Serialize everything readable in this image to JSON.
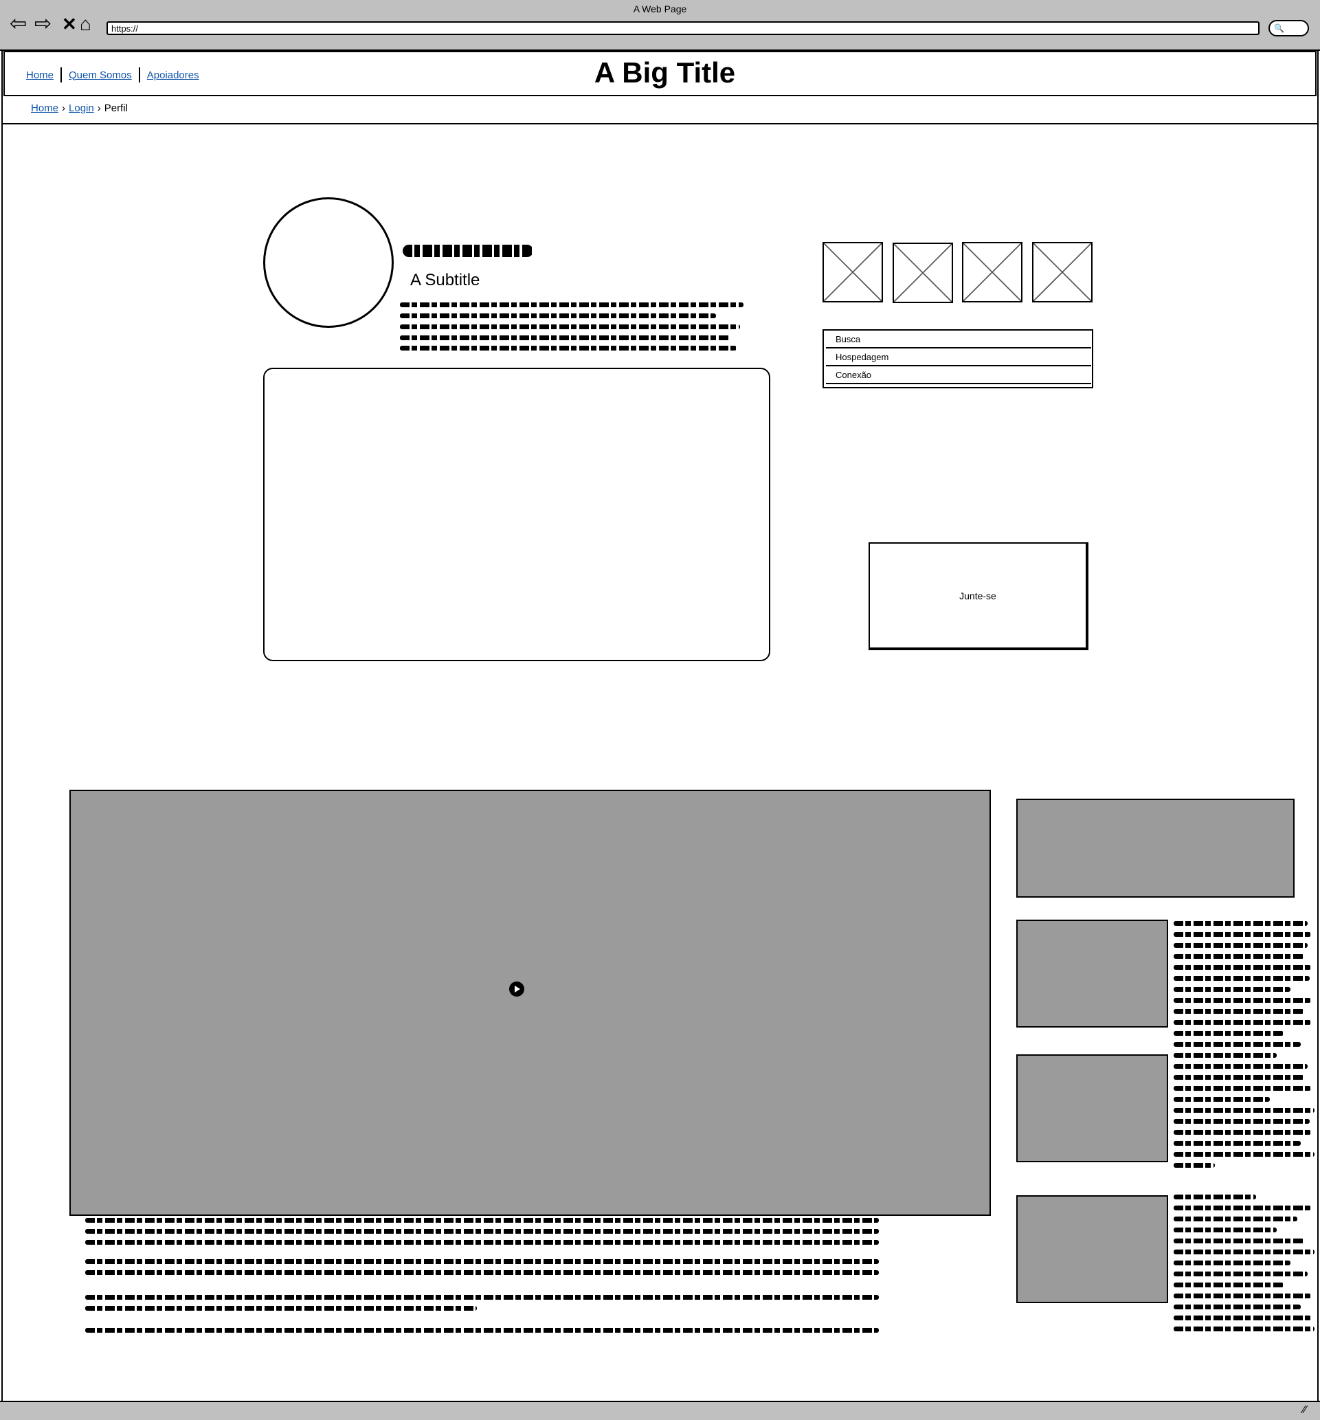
{
  "window": {
    "title": "A Web Page"
  },
  "browser": {
    "url": "https://"
  },
  "header": {
    "nav": [
      "Home",
      "Quem Somos",
      "Apoiadores"
    ],
    "title": "A Big Title"
  },
  "breadcrumb": {
    "items": [
      "Home",
      "Login"
    ],
    "current": "Perfil"
  },
  "profile": {
    "subtitle": "A Subtitle"
  },
  "menu": {
    "items": [
      "Busca",
      "Hospedagem",
      "Conexão"
    ]
  },
  "join_button": {
    "label": "Junte-se"
  },
  "icons": [
    "back-arrow-icon",
    "forward-arrow-icon",
    "stop-icon",
    "home-icon",
    "search-icon",
    "play-icon",
    "resize-grip-icon"
  ]
}
